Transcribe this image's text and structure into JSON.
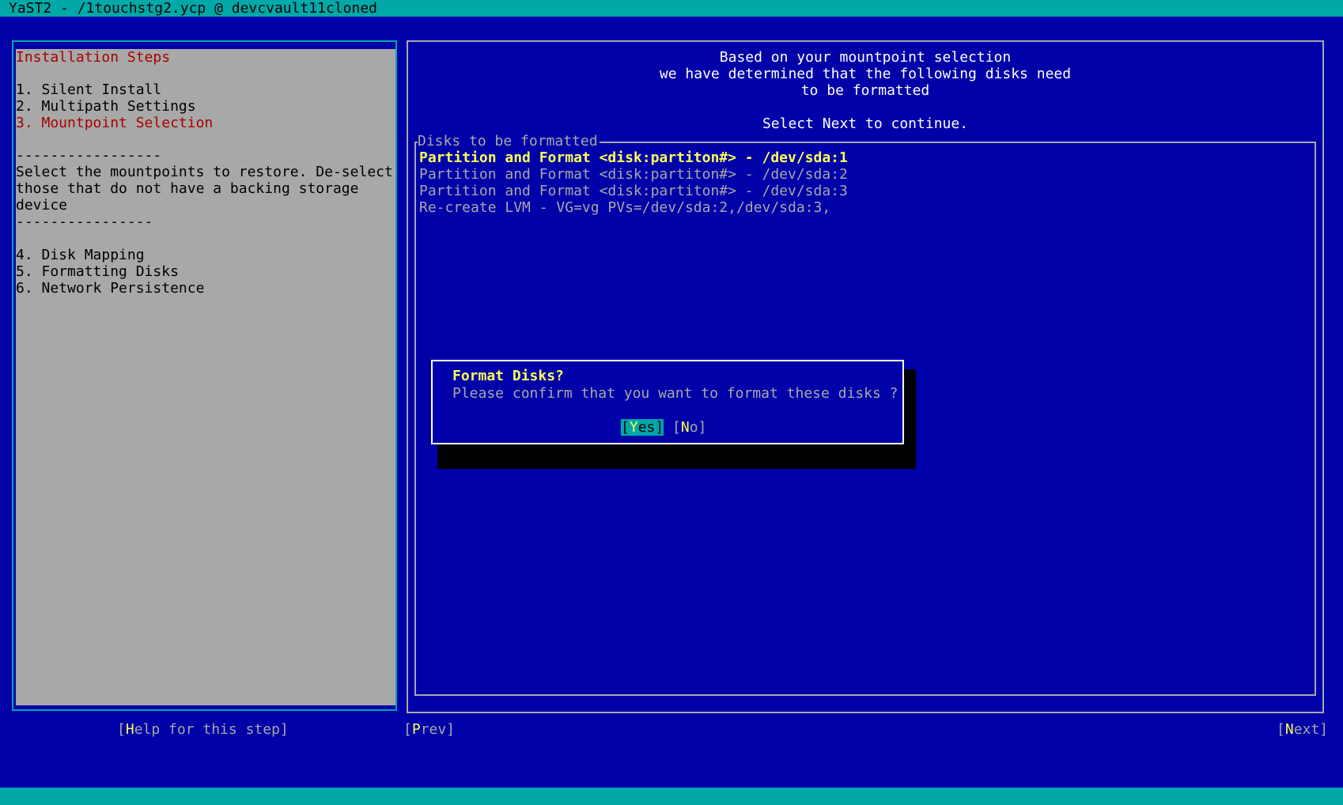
{
  "window": {
    "title": "YaST2 - /1touchstg2.ycp @ devcvault11cloned"
  },
  "sidebar": {
    "heading": "Installation Steps",
    "steps_before": [
      {
        "label": "1. Silent Install"
      },
      {
        "label": "2. Multipath Settings"
      }
    ],
    "current_step": "3. Mountpoint Selection",
    "separator_top": "-----------------",
    "description": [
      "Select the mountpoints to restore. De-select",
      "those that do not have a backing storage",
      "device"
    ],
    "separator_bottom": "----------------",
    "steps_after": [
      {
        "label": "4. Disk Mapping"
      },
      {
        "label": "5. Formatting Disks"
      },
      {
        "label": "6. Network Persistence"
      }
    ]
  },
  "main": {
    "intro": [
      "Based on your mountpoint selection",
      "we have determined that the following disks need",
      "to be formatted"
    ],
    "instruction": "Select Next to continue.",
    "disks_label": "Disks to be formatted",
    "disks": [
      {
        "text": "Partition and Format <disk:partiton#> - /dev/sda:1",
        "selected": true
      },
      {
        "text": "Partition and Format <disk:partiton#> - /dev/sda:2",
        "selected": false
      },
      {
        "text": "Partition and Format <disk:partiton#> - /dev/sda:3",
        "selected": false
      },
      {
        "text": "Re-create LVM - VG=vg PVs=/dev/sda:2,/dev/sda:3,",
        "selected": false
      }
    ]
  },
  "dialog": {
    "title": "Format Disks?",
    "message": "Please confirm that you want to format these disks ?",
    "yes": {
      "open": "[",
      "hot": "Y",
      "rest": "es",
      "close": "]"
    },
    "no": {
      "open": "[",
      "hot": "N",
      "rest": "o",
      "close": "]"
    }
  },
  "footer": {
    "help": {
      "open": "[",
      "hot": "H",
      "rest": "elp for this step",
      "close": "]"
    },
    "prev": {
      "open": "[",
      "hot": "P",
      "rest": "rev",
      "close": "]"
    },
    "next": {
      "open": "[",
      "hot": "N",
      "rest": "ext",
      "close": "]"
    }
  },
  "colors": {
    "background": "#0000a8",
    "titlebar": "#00a8a8",
    "sidebar_bg": "#a8a8a8",
    "current_step": "#a80000",
    "highlight": "#ffff54",
    "text": "#a8a8a8"
  }
}
